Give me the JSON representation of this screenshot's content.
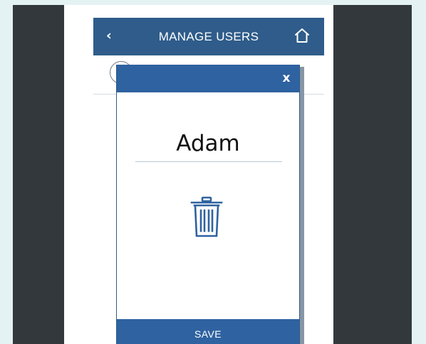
{
  "app": {
    "title": "MANAGE USERS"
  },
  "header": {
    "back_icon": "chevron-left",
    "back_glyph": "‹",
    "home_icon": "home"
  },
  "modal": {
    "close_glyph": "x",
    "user_name": "Adam",
    "delete_icon": "trash",
    "save_label": "SAVE"
  },
  "colors": {
    "page_background": "#e4f2f3",
    "frame": "#33383c",
    "header_blue": "#2f5c8a",
    "modal_blue": "#2f62a0",
    "icon_blue": "#2f62a0"
  }
}
